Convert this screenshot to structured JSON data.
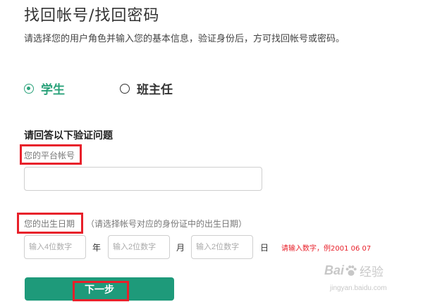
{
  "page": {
    "title": "找回帐号/找回密码",
    "intro": "请选择您的用户角色并输入您的基本信息，验证身份后，方可找回帐号或密码。"
  },
  "roles": {
    "student_label": "学生",
    "teacher_label": "班主任",
    "selected": "student"
  },
  "form": {
    "question_heading": "请回答以下验证问题",
    "account_label": "您的平台帐号",
    "account_value": "",
    "birth_label": "您的出生日期",
    "birth_hint": "（请选择帐号对应的身份证中的出生日期）",
    "year_placeholder": "输入4位数字",
    "month_placeholder": "输入2位数字",
    "day_placeholder": "输入2位数字",
    "year_unit": "年",
    "month_unit": "月",
    "day_unit": "日",
    "date_error": "请输入数字，例2001 06 07"
  },
  "actions": {
    "next_label": "下一步"
  },
  "watermark": {
    "brand_left": "Bai",
    "brand_right": "经验",
    "url": "jingyan.baidu.com"
  },
  "colors": {
    "accent": "#2aa27a",
    "button": "#1e9a7a",
    "highlight": "#e8202a"
  }
}
